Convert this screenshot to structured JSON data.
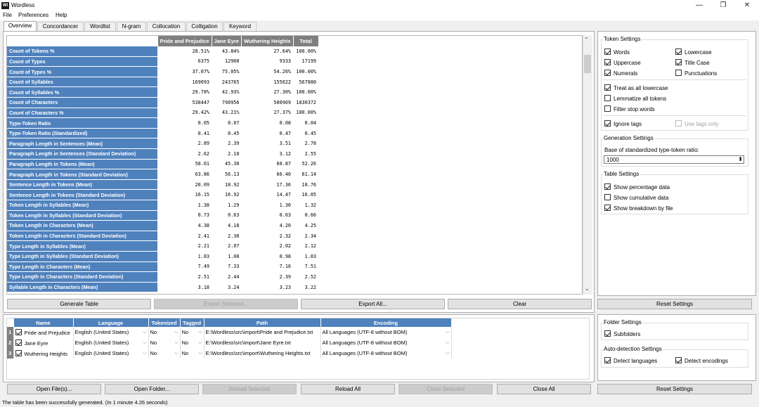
{
  "window": {
    "title": "Wordless",
    "icon_text": "Wl",
    "min": "—",
    "max": "❐",
    "close": "✕"
  },
  "menu": [
    "File",
    "Preferences",
    "Help"
  ],
  "tabs": [
    "Overview",
    "Concordancer",
    "Wordlist",
    "N-gram",
    "Collocation",
    "Colligation",
    "Keyword"
  ],
  "overview": {
    "columns": [
      "Pride and Prejudice",
      "Jane Eyre",
      "Wuthering Heights",
      "Total"
    ],
    "rows": [
      {
        "label": "Count of Tokens %",
        "values": [
          "28.51%",
          "43.84%",
          "27.64%",
          "100.00%"
        ]
      },
      {
        "label": "Count of Types",
        "values": [
          "6375",
          "12908",
          "9333",
          "17199"
        ]
      },
      {
        "label": "Count of Types %",
        "values": [
          "37.07%",
          "75.05%",
          "54.26%",
          "100.00%"
        ]
      },
      {
        "label": "Count of Syllables",
        "values": [
          "169093",
          "243765",
          "155022",
          "567880"
        ]
      },
      {
        "label": "Count of Syllables %",
        "values": [
          "29.78%",
          "42.93%",
          "27.30%",
          "100.00%"
        ]
      },
      {
        "label": "Count of Characters",
        "values": [
          "538447",
          "790956",
          "500969",
          "1830372"
        ]
      },
      {
        "label": "Count of Characters %",
        "values": [
          "29.42%",
          "43.21%",
          "27.37%",
          "100.00%"
        ]
      },
      {
        "label": "Type-Token Ratio",
        "values": [
          "0.05",
          "0.07",
          "0.08",
          "0.04"
        ]
      },
      {
        "label": "Type-Token Ratio (Standardized)",
        "values": [
          "0.41",
          "0.45",
          "0.47",
          "0.45"
        ]
      },
      {
        "label": "Paragraph Length in Sentences (Mean)",
        "values": [
          "2.89",
          "2.39",
          "3.51",
          "2.78"
        ]
      },
      {
        "label": "Paragraph Length in Sentences (Standard Deviation)",
        "values": [
          "2.62",
          "2.10",
          "3.12",
          "2.55"
        ]
      },
      {
        "label": "Paragraph Length in Tokens (Mean)",
        "values": [
          "58.01",
          "45.30",
          "60.87",
          "52.26"
        ]
      },
      {
        "label": "Paragraph Length in Tokens (Standard Deviation)",
        "values": [
          "63.86",
          "56.13",
          "66.40",
          "61.14"
        ]
      },
      {
        "label": "Sentence Length in Tokens (Mean)",
        "values": [
          "20.09",
          "18.92",
          "17.36",
          "18.76"
        ]
      },
      {
        "label": "Sentence Length in Tokens (Standard Deviation)",
        "values": [
          "16.15",
          "16.92",
          "14.47",
          "16.05"
        ]
      },
      {
        "label": "Token Length in Syllables (Mean)",
        "values": [
          "1.38",
          "1.29",
          "1.30",
          "1.32"
        ]
      },
      {
        "label": "Token Length in Syllables (Standard Deviation)",
        "values": [
          "0.73",
          "0.63",
          "0.63",
          "0.66"
        ]
      },
      {
        "label": "Token Length in Characters (Mean)",
        "values": [
          "4.38",
          "4.18",
          "4.20",
          "4.25"
        ]
      },
      {
        "label": "Token Length in Characters (Standard Deviation)",
        "values": [
          "2.41",
          "2.30",
          "2.32",
          "2.34"
        ]
      },
      {
        "label": "Type Length in Syllables (Mean)",
        "values": [
          "2.21",
          "2.07",
          "2.02",
          "2.12"
        ]
      },
      {
        "label": "Type Length in Syllables (Standard Deviation)",
        "values": [
          "1.03",
          "1.00",
          "0.98",
          "1.03"
        ]
      },
      {
        "label": "Type Length in Characters (Mean)",
        "values": [
          "7.49",
          "7.33",
          "7.16",
          "7.51"
        ]
      },
      {
        "label": "Type Length in Characters (Standard Deviation)",
        "values": [
          "2.51",
          "2.44",
          "2.39",
          "2.52"
        ]
      },
      {
        "label": "Syllable Length in Characters (Mean)",
        "values": [
          "3.18",
          "3.24",
          "3.23",
          "3.22"
        ]
      }
    ]
  },
  "buttons": {
    "generate": "Generate Table",
    "export_selected": "Export Selected...",
    "export_all": "Export All...",
    "clear": "Clear",
    "reset_top": "Reset Settings",
    "open_files": "Open File(s)...",
    "open_folder": "Open Folder...",
    "reload_selected": "Reload Selected",
    "reload_all": "Reload All",
    "close_selected": "Close Selected",
    "close_all": "Close All",
    "reset_bottom": "Reset Settings"
  },
  "token_settings": {
    "title": "Token Settings",
    "words": "Words",
    "lowercase": "Lowercase",
    "uppercase": "Uppercase",
    "title_case": "Title Case",
    "numerals": "Numerals",
    "punctuations": "Punctuations",
    "treat_lowercase": "Treat as all lowercase",
    "lemmatize": "Lemmatize all tokens",
    "filter_stop": "Filter stop words",
    "ignore_tags": "Ignore tags",
    "use_tags_only": "Use tags only"
  },
  "generation_settings": {
    "title": "Generation Settings",
    "base_label": "Base of standardized type-token ratio:",
    "base_value": "1000"
  },
  "table_settings": {
    "title": "Table Settings",
    "show_pct": "Show percentage data",
    "show_cum": "Show cumulative data",
    "show_breakdown": "Show breakdown by file"
  },
  "files": {
    "headers": [
      "Name",
      "Language",
      "Tokenized",
      "Tagged",
      "Path",
      "Encoding"
    ],
    "rows": [
      {
        "num": "1",
        "name": "Pride and Prejudice",
        "language": "English (United States)",
        "tokenized": "No",
        "tagged": "No",
        "path": "E:\\Wordless\\src\\import\\Pride and Prejudice.txt",
        "encoding": "All Languages (UTF-8 without BOM)"
      },
      {
        "num": "2",
        "name": "Jane Eyre",
        "language": "English (United States)",
        "tokenized": "No",
        "tagged": "No",
        "path": "E:\\Wordless\\src\\import\\Jane Eyre.txt",
        "encoding": "All Languages (UTF-8 without BOM)"
      },
      {
        "num": "3",
        "name": "Wuthering Heights",
        "language": "English (United States)",
        "tokenized": "No",
        "tagged": "No",
        "path": "E:\\Wordless\\src\\import\\Wuthering Heights.txt",
        "encoding": "All Languages (UTF-8 without BOM)"
      }
    ]
  },
  "folder_settings": {
    "title": "Folder Settings",
    "subfolders": "Subfolders"
  },
  "auto_detection": {
    "title": "Auto-detection Settings",
    "detect_languages": "Detect languages",
    "detect_encodings": "Detect encodings"
  },
  "status": "The table has been successfully generated. (In 1 minute 4.26 seconds)",
  "icons": {
    "chevron": "⌵",
    "scroll_up": "⌃",
    "scroll_down": "⌄",
    "spin": "⬍"
  }
}
